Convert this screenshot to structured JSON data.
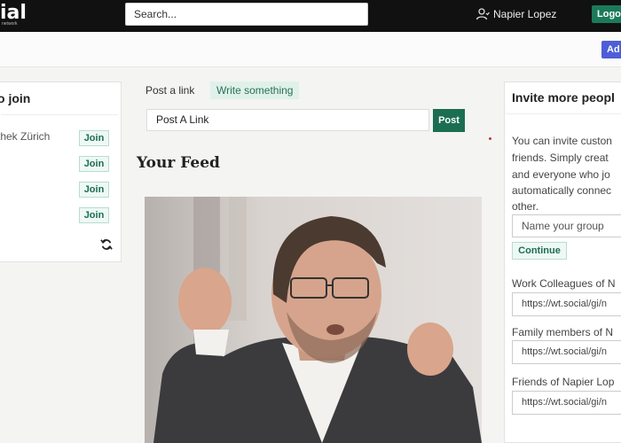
{
  "brand": {
    "logo_text": "ial",
    "logo_subtext": "network"
  },
  "header": {
    "search_value": "Search...",
    "user_name": "Napier Lopez",
    "logout_label": "Logout"
  },
  "subbar": {
    "add_label": "Ad"
  },
  "groups_panel": {
    "title": "o join",
    "groups": [
      {
        "name": "thek Zürich",
        "join_label": "Join"
      },
      {
        "name": "",
        "join_label": "Join"
      },
      {
        "name": "",
        "join_label": "Join"
      },
      {
        "name": "",
        "join_label": "Join"
      }
    ]
  },
  "post_tabs": [
    "Post a link",
    "Write something"
  ],
  "post_form": {
    "input_value": "Post A Link",
    "post_label": "Post"
  },
  "feed": {
    "title": "Your Feed"
  },
  "invite_panel": {
    "title": "Invite more peopl",
    "description_lines": [
      "You can invite custon",
      "friends. Simply creat",
      "and everyone who jo",
      "automatically connec",
      "other."
    ],
    "group_input_value": "Name your group",
    "continue_label": "Continue",
    "invites": [
      {
        "label": "Work Colleagues of N",
        "url": "https://wt.social/gi/n"
      },
      {
        "label": "Family members of N",
        "url": "https://wt.social/gi/n"
      },
      {
        "label": "Friends of Napier Lop",
        "url": "https://wt.social/gi/n"
      }
    ]
  },
  "colors": {
    "accent_green": "#1b6e52",
    "header_bg": "#111111",
    "add_blue": "#4e5ed6"
  }
}
